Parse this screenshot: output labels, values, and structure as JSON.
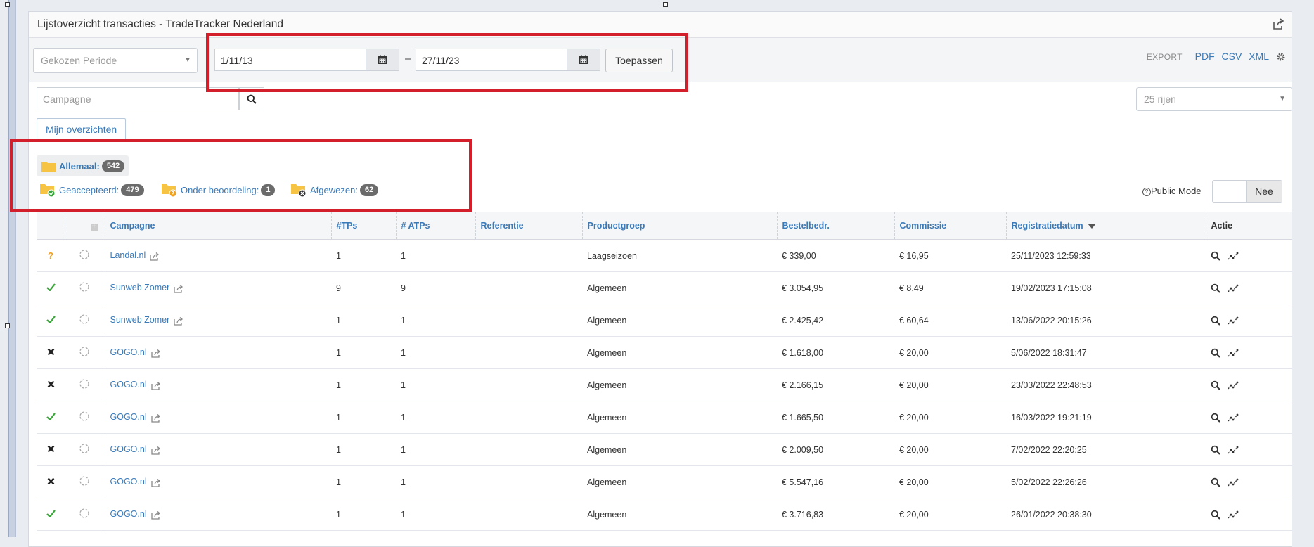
{
  "panel": {
    "title": "Lijstoverzicht transacties - TradeTracker Nederland"
  },
  "toolbar": {
    "period_select": "Gekozen Periode",
    "date_from": "1/11/13",
    "date_to": "27/11/23",
    "separator": "–",
    "apply_label": "Toepassen",
    "export_label": "EXPORT",
    "export_pdf": "PDF",
    "export_csv": "CSV",
    "export_xml": "XML"
  },
  "filter": {
    "campaign_placeholder": "Campagne",
    "rows_select": "25 rijen",
    "my_overviews": "Mijn overzichten"
  },
  "folders": {
    "all_label": "Allemaal:",
    "all_count": "542",
    "accepted_label": "Geaccepteerd:",
    "accepted_count": "479",
    "pending_label": "Onder beoordeling:",
    "pending_count": "1",
    "rejected_label": "Afgewezen:",
    "rejected_count": "62"
  },
  "public_mode": {
    "label": "Public Mode",
    "value": "Nee"
  },
  "table": {
    "headers": {
      "campaign": "Campagne",
      "tps": "#TPs",
      "atps": "# ATPs",
      "reference": "Referentie",
      "product_group": "Productgroep",
      "order_amount": "Bestelbedr.",
      "commission": "Commissie",
      "registration_date": "Registratiedatum",
      "action": "Actie"
    },
    "rows": [
      {
        "status": "pending",
        "campaign": "Landal.nl",
        "tps": "1",
        "atps": "1",
        "reference": "",
        "product_group": "Laagseizoen",
        "order_amount": "€ 339,00",
        "commission": "€ 16,95",
        "date": "25/11/2023 12:59:33"
      },
      {
        "status": "accepted",
        "campaign": "Sunweb Zomer",
        "tps": "9",
        "atps": "9",
        "reference": "",
        "product_group": "Algemeen",
        "order_amount": "€ 3.054,95",
        "commission": "€ 8,49",
        "date": "19/02/2023 17:15:08"
      },
      {
        "status": "accepted",
        "campaign": "Sunweb Zomer",
        "tps": "1",
        "atps": "1",
        "reference": "",
        "product_group": "Algemeen",
        "order_amount": "€ 2.425,42",
        "commission": "€ 60,64",
        "date": "13/06/2022 20:15:26"
      },
      {
        "status": "rejected",
        "campaign": "GOGO.nl",
        "tps": "1",
        "atps": "1",
        "reference": "",
        "product_group": "Algemeen",
        "order_amount": "€ 1.618,00",
        "commission": "€ 20,00",
        "date": "5/06/2022 18:31:47"
      },
      {
        "status": "rejected",
        "campaign": "GOGO.nl",
        "tps": "1",
        "atps": "1",
        "reference": "",
        "product_group": "Algemeen",
        "order_amount": "€ 2.166,15",
        "commission": "€ 20,00",
        "date": "23/03/2022 22:48:53"
      },
      {
        "status": "accepted",
        "campaign": "GOGO.nl",
        "tps": "1",
        "atps": "1",
        "reference": "",
        "product_group": "Algemeen",
        "order_amount": "€ 1.665,50",
        "commission": "€ 20,00",
        "date": "16/03/2022 19:21:19"
      },
      {
        "status": "rejected",
        "campaign": "GOGO.nl",
        "tps": "1",
        "atps": "1",
        "reference": "",
        "product_group": "Algemeen",
        "order_amount": "€ 2.009,50",
        "commission": "€ 20,00",
        "date": "7/02/2022 22:20:25"
      },
      {
        "status": "rejected",
        "campaign": "GOGO.nl",
        "tps": "1",
        "atps": "1",
        "reference": "",
        "product_group": "Algemeen",
        "order_amount": "€ 5.547,16",
        "commission": "€ 20,00",
        "date": "5/02/2022 22:26:26"
      },
      {
        "status": "accepted",
        "campaign": "GOGO.nl",
        "tps": "1",
        "atps": "1",
        "reference": "",
        "product_group": "Algemeen",
        "order_amount": "€ 3.716,83",
        "commission": "€ 20,00",
        "date": "26/01/2022 20:38:30"
      }
    ]
  },
  "colors": {
    "link": "#3a7ab8",
    "highlight_box": "#d21f2b",
    "accepted": "#3aa53a",
    "pending": "#f0a01e",
    "rejected": "#222222",
    "folder": "#f6c343"
  }
}
